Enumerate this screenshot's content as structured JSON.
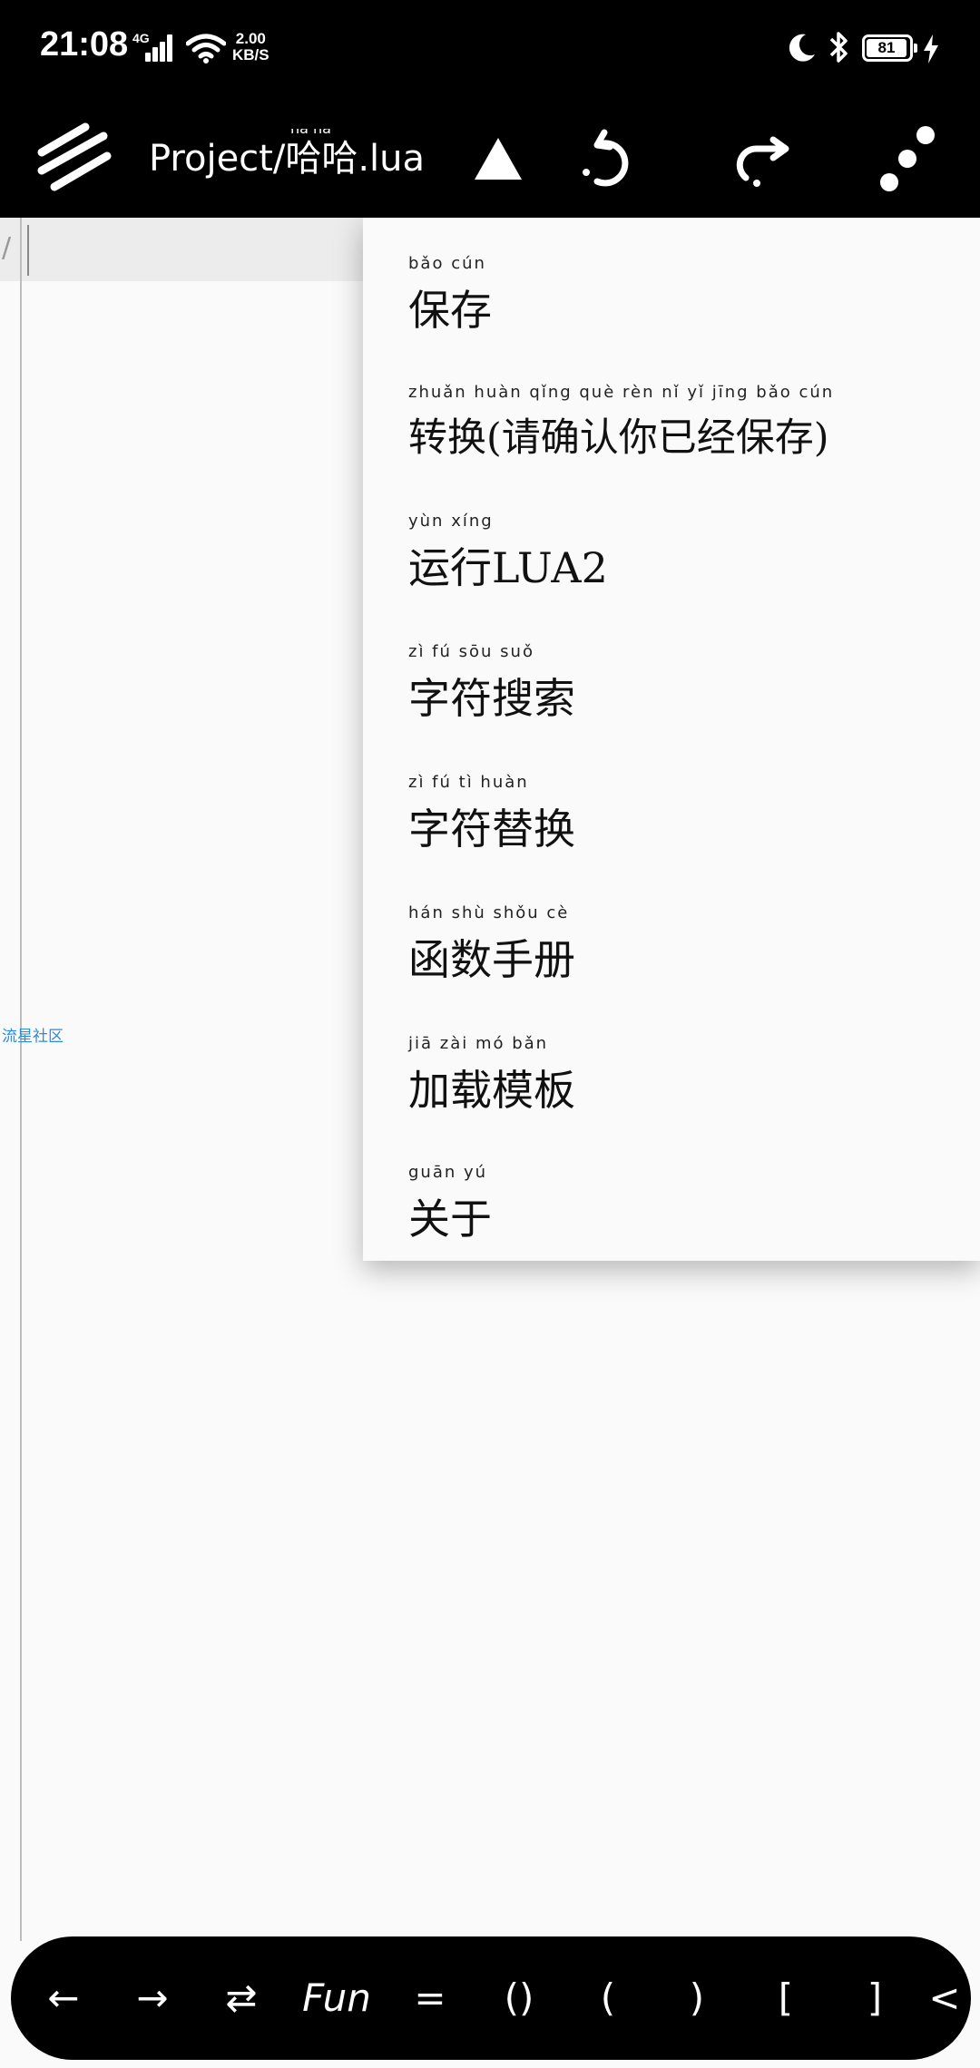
{
  "status_bar": {
    "time": "21:08",
    "network": "4G",
    "speed_value": "2.00",
    "speed_unit": "KB/S",
    "battery": "81"
  },
  "toolbar": {
    "title": "Project/哈哈.lua",
    "title_ruby": "hā hā"
  },
  "editor": {
    "watermark": "流星社区"
  },
  "menu": {
    "items": [
      {
        "pinyin": "bǎo  cún",
        "label": "保存"
      },
      {
        "pinyin": "zhuǎn huàn   qǐng  què  rèn   nǐ    yǐ   jīng  bǎo  cún",
        "label": "转换(请确认你已经保存)"
      },
      {
        "pinyin": "yùn  xíng",
        "label": "运行LUA2"
      },
      {
        "pinyin": "zì    fú   sōu  suǒ",
        "label": "字符搜索"
      },
      {
        "pinyin": "zì    fú    tì   huàn",
        "label": "字符替换"
      },
      {
        "pinyin": "hán  shù  shǒu   cè",
        "label": "函数手册"
      },
      {
        "pinyin": "jiā   zài   mó   bǎn",
        "label": "加载模板"
      },
      {
        "pinyin": "guān  yú",
        "label": "关于"
      }
    ]
  },
  "bottom_keys": [
    "←",
    "→",
    "⇄",
    "Fun",
    "=",
    "()",
    "(",
    ")",
    "[",
    "]",
    "<"
  ]
}
